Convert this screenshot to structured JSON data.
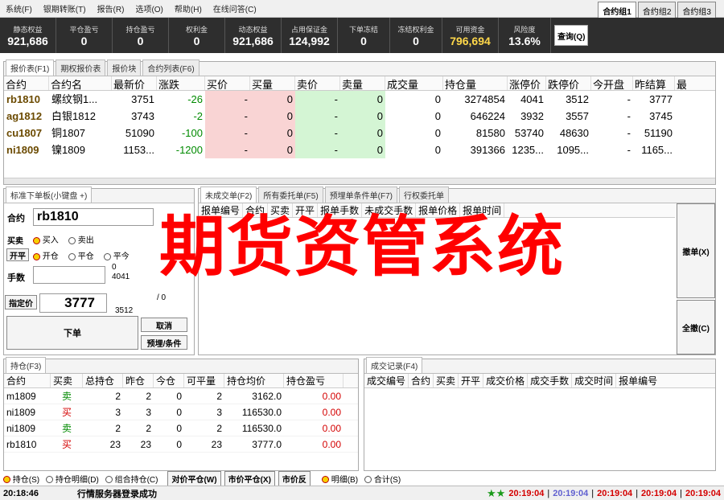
{
  "menu": [
    "系统(F)",
    "银期转账(T)",
    "报告(R)",
    "选项(O)",
    "帮助(H)",
    "在线问答(C)"
  ],
  "group_tabs": [
    "合约组1",
    "合约组2",
    "合约组3"
  ],
  "account": [
    {
      "label": "静态权益",
      "value": "921,686"
    },
    {
      "label": "平仓盈亏",
      "value": "0"
    },
    {
      "label": "持仓盈亏",
      "value": "0"
    },
    {
      "label": "权利金",
      "value": "0"
    },
    {
      "label": "动态权益",
      "value": "921,686"
    },
    {
      "label": "占用保证金",
      "value": "124,992"
    },
    {
      "label": "下单冻结",
      "value": "0"
    },
    {
      "label": "冻结权利金",
      "value": "0"
    },
    {
      "label": "可用资金",
      "value": "796,694"
    },
    {
      "label": "风险度",
      "value": "13.6%"
    }
  ],
  "query_label": "查询(Q)",
  "quote_tabs": [
    "报价表(F1)",
    "期权报价表",
    "报价块",
    "合约列表(F6)"
  ],
  "quote_headers": [
    "合约",
    "合约名",
    "最新价",
    "涨跌",
    "买价",
    "买量",
    "卖价",
    "卖量",
    "成交量",
    "持仓量",
    "涨停价",
    "跌停价",
    "今开盘",
    "昨结算",
    "最"
  ],
  "quotes": [
    {
      "sym": "rb1810",
      "name": "螺纹钢1...",
      "last": "3751",
      "chg": "-26",
      "bid": "-",
      "bidv": "0",
      "ask": "-",
      "askv": "0",
      "vol": "0",
      "oi": "3274854",
      "up": "4041",
      "down": "3512",
      "open": "-",
      "settle": "3777"
    },
    {
      "sym": "ag1812",
      "name": "白银1812",
      "last": "3743",
      "chg": "-2",
      "bid": "-",
      "bidv": "0",
      "ask": "-",
      "askv": "0",
      "vol": "0",
      "oi": "646224",
      "up": "3932",
      "down": "3557",
      "open": "-",
      "settle": "3745"
    },
    {
      "sym": "cu1807",
      "name": "铜1807",
      "last": "51090",
      "chg": "-100",
      "bid": "-",
      "bidv": "0",
      "ask": "-",
      "askv": "0",
      "vol": "0",
      "oi": "81580",
      "up": "53740",
      "down": "48630",
      "open": "-",
      "settle": "51190"
    },
    {
      "sym": "ni1809",
      "name": "镍1809",
      "last": "1153...",
      "chg": "-1200",
      "bid": "-",
      "bidv": "0",
      "ask": "-",
      "askv": "0",
      "vol": "0",
      "oi": "391366",
      "up": "1235...",
      "down": "1095...",
      "open": "-",
      "settle": "1165..."
    }
  ],
  "order_panel": {
    "title": "标准下单板(小键盘 +)",
    "contract_label": "合约",
    "contract_value": "rb1810",
    "side_label": "买卖",
    "buy": "买入",
    "sell": "卖出",
    "open_label": "开平",
    "open": "开仓",
    "close": "平仓",
    "closetoday": "平今",
    "qty_label": "手数",
    "price_label": "指定价",
    "price": "3777",
    "ladder": [
      "0",
      "4041",
      "3512"
    ],
    "ladder_right": "/ 0",
    "submit": "下单",
    "cancel": "取消",
    "preorder": "预埋/条件"
  },
  "order_tabs": [
    "未成交单(F2)",
    "所有委托单(F5)",
    "预埋单条件单(F7)",
    "行权委托单"
  ],
  "order_headers": [
    "报单编号",
    "合约",
    "买卖",
    "开平",
    "报单手数",
    "未成交手数",
    "报单价格",
    "报单时间"
  ],
  "cancel_one": "撤单(X)",
  "cancel_all": "全撤(C)",
  "pos_tab": "持仓(F3)",
  "pos_headers": [
    "合约",
    "买卖",
    "总持仓",
    "昨仓",
    "今仓",
    "可平量",
    "持仓均价",
    "持仓盈亏"
  ],
  "positions": [
    {
      "sym": "m1809",
      "side": "卖",
      "total": "2",
      "yd": "2",
      "td": "0",
      "avail": "2",
      "avg": "3162.0",
      "pnl": "0.00"
    },
    {
      "sym": "ni1809",
      "side": "买",
      "total": "3",
      "yd": "3",
      "td": "0",
      "avail": "3",
      "avg": "116530.0",
      "pnl": "0.00"
    },
    {
      "sym": "ni1809",
      "side": "卖",
      "total": "2",
      "yd": "2",
      "td": "0",
      "avail": "2",
      "avg": "116530.0",
      "pnl": "0.00"
    },
    {
      "sym": "rb1810",
      "side": "买",
      "total": "23",
      "yd": "23",
      "td": "0",
      "avail": "23",
      "avg": "3777.0",
      "pnl": "0.00"
    }
  ],
  "trade_tab": "成交记录(F4)",
  "trade_headers": [
    "成交编号",
    "合约",
    "买卖",
    "开平",
    "成交价格",
    "成交手数",
    "成交时间",
    "报单编号"
  ],
  "bottom_radios": [
    "持仓(S)",
    "持仓明细(D)",
    "组合持仓(C)"
  ],
  "bottom_buttons": [
    "对价平仓(W)",
    "市价平仓(X)",
    "市价反"
  ],
  "trade_radios": [
    "明细(B)",
    "合计(S)"
  ],
  "status": {
    "time": "20:18:46",
    "message": "行情服务器登录成功",
    "times": [
      "20:19:04",
      "20:19:04",
      "20:19:04",
      "20:19:04",
      "20:19:04"
    ]
  },
  "watermark": "期货资管系统"
}
